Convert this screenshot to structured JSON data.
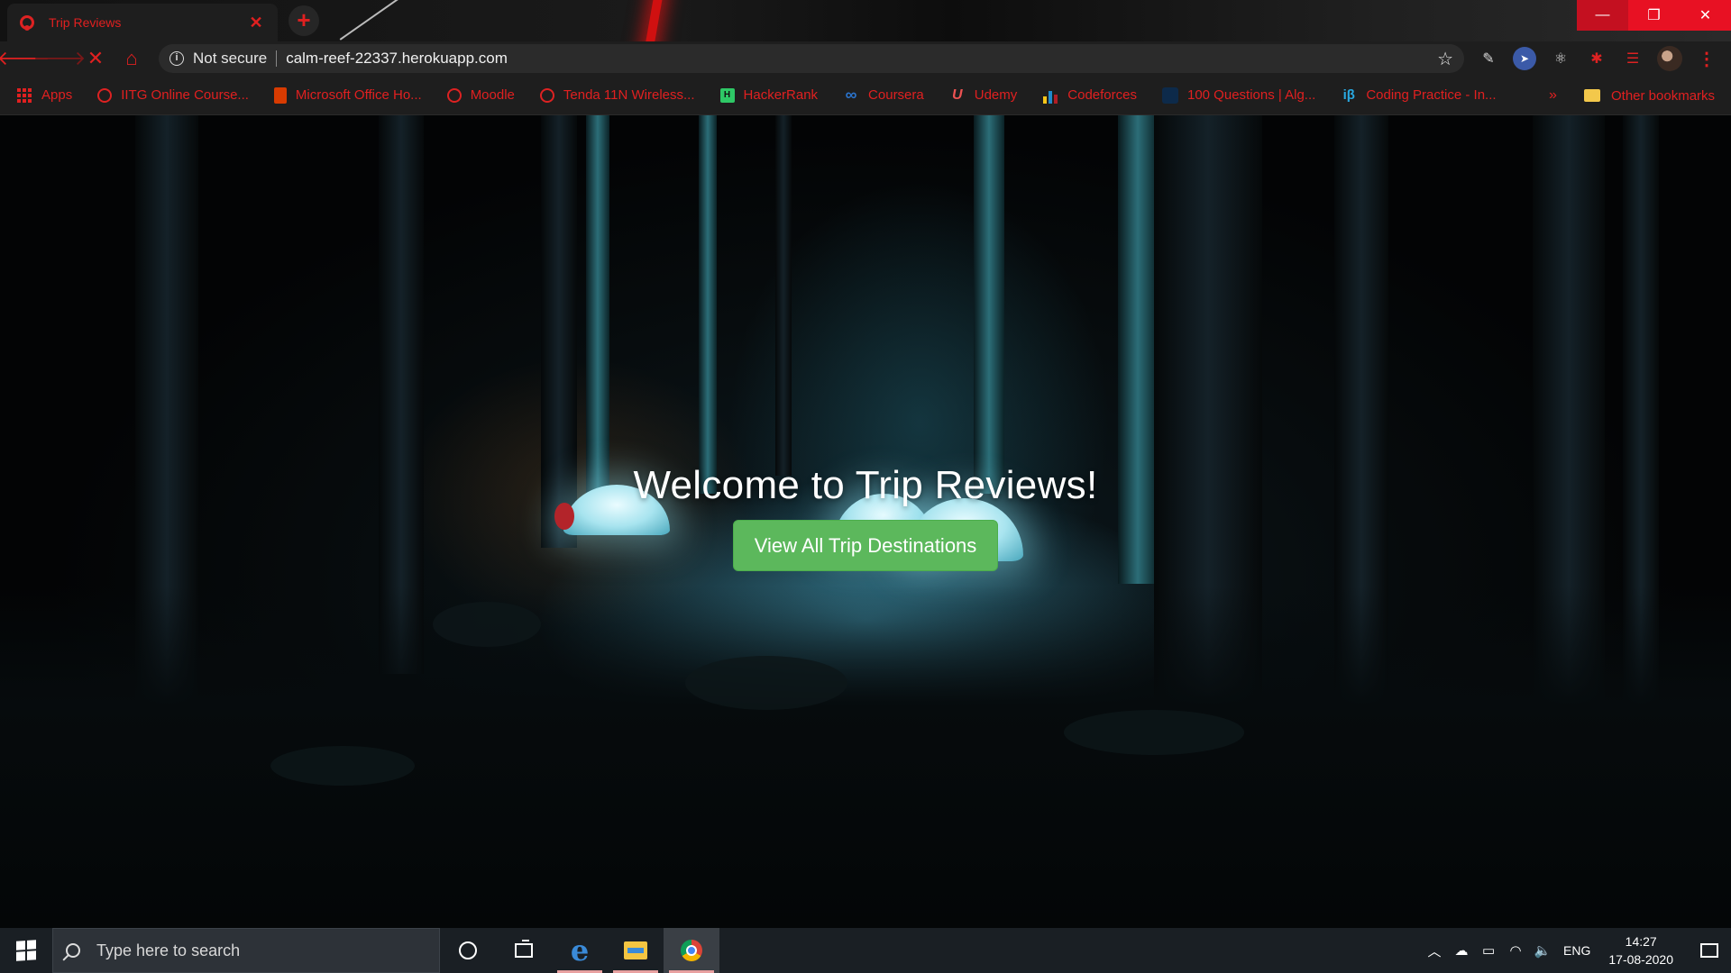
{
  "browser": {
    "tab": {
      "title": "Trip Reviews"
    },
    "new_tab_label": "+",
    "security_text": "Not secure",
    "url": "calm-reef-22337.herokuapp.com",
    "bookmarks": [
      {
        "label": "Apps",
        "icon": "apps-grid-icon"
      },
      {
        "label": "IITG Online Course...",
        "icon": "globe-icon"
      },
      {
        "label": "Microsoft Office Ho...",
        "icon": "office-icon"
      },
      {
        "label": "Moodle",
        "icon": "globe-icon"
      },
      {
        "label": "Tenda 11N Wireless...",
        "icon": "globe-icon"
      },
      {
        "label": "HackerRank",
        "icon": "hackerrank-icon"
      },
      {
        "label": "Coursera",
        "icon": "coursera-icon"
      },
      {
        "label": "Udemy",
        "icon": "udemy-icon"
      },
      {
        "label": "Codeforces",
        "icon": "codeforces-icon"
      },
      {
        "label": "100 Questions | Alg...",
        "icon": "site-icon"
      },
      {
        "label": "Coding Practice - In...",
        "icon": "interviewbit-icon"
      }
    ],
    "other_bookmarks": "Other bookmarks",
    "accent_color": "#e02020"
  },
  "page": {
    "heading": "Welcome to Trip Reviews!",
    "cta_label": "View All Trip Destinations",
    "cta_color": "#5cb85c"
  },
  "taskbar": {
    "search_placeholder": "Type here to search",
    "language": "ENG",
    "time": "14:27",
    "date": "17-08-2020"
  }
}
